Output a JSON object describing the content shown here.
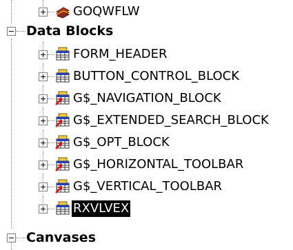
{
  "tree": {
    "selection_color": "#000000",
    "nodes": [
      {
        "id": "goqwflw",
        "label": "GOQWFLW",
        "bold": false,
        "icon": "library-books-icon",
        "expander": "plus",
        "selected": false
      },
      {
        "id": "data-blocks",
        "label": "Data Blocks",
        "bold": true,
        "icon": null,
        "expander": "minus",
        "selected": false
      },
      {
        "id": "form-header",
        "label": "FORM_HEADER",
        "bold": false,
        "icon": "data-block-icon",
        "expander": "plus",
        "selected": false
      },
      {
        "id": "button-control-block",
        "label": "BUTTON_CONTROL_BLOCK",
        "bold": false,
        "icon": "data-block-icon",
        "expander": "plus",
        "selected": false
      },
      {
        "id": "g-navigation-block",
        "label": "G$_NAVIGATION_BLOCK",
        "bold": false,
        "icon": "subclassed-data-block-icon",
        "expander": "plus",
        "selected": false
      },
      {
        "id": "g-extended-search-block",
        "label": "G$_EXTENDED_SEARCH_BLOCK",
        "bold": false,
        "icon": "subclassed-data-block-icon",
        "expander": "plus",
        "selected": false
      },
      {
        "id": "g-opt-block",
        "label": "G$_OPT_BLOCK",
        "bold": false,
        "icon": "subclassed-data-block-icon",
        "expander": "plus",
        "selected": false
      },
      {
        "id": "g-horizontal-toolbar",
        "label": "G$_HORIZONTAL_TOOLBAR",
        "bold": false,
        "icon": "subclassed-data-block-icon",
        "expander": "plus",
        "selected": false
      },
      {
        "id": "g-vertical-toolbar",
        "label": "G$_VERTICAL_TOOLBAR",
        "bold": false,
        "icon": "subclassed-data-block-icon",
        "expander": "plus",
        "selected": false
      },
      {
        "id": "rxvlvex",
        "label": "RXVLVEX",
        "bold": false,
        "icon": "data-block-icon",
        "expander": "plus",
        "selected": true
      },
      {
        "id": "canvases",
        "label": "Canvases",
        "bold": true,
        "icon": null,
        "expander": "minus",
        "selected": false
      }
    ]
  }
}
